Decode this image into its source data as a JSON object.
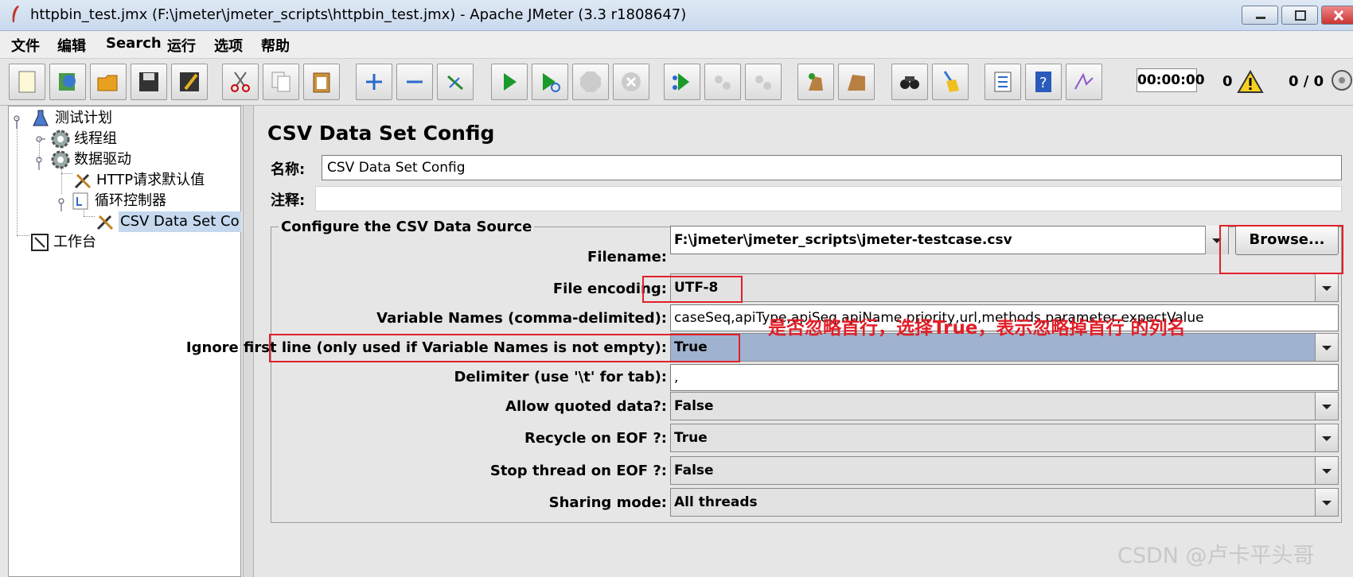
{
  "window": {
    "title": "httpbin_test.jmx (F:\\jmeter\\jmeter_scripts\\httpbin_test.jmx) - Apache JMeter (3.3 r1808647)"
  },
  "menu": [
    "文件",
    "编辑",
    "Search",
    "运行",
    "选项",
    "帮助"
  ],
  "toolbar": {
    "timer": "00:00:00",
    "error_count": "0",
    "thread_count": "0 / 0",
    "icons": [
      "new-icon",
      "templates-icon",
      "open-icon",
      "save-icon",
      "save-as-icon",
      "cut-icon",
      "copy-icon",
      "paste-icon",
      "expand-icon",
      "collapse-icon",
      "toggle-icon",
      "start-icon",
      "start-no-pause-icon",
      "stop-icon",
      "shutdown-icon",
      "remote-start-icon",
      "remote-stop-icon",
      "remote-exit-icon",
      "clear-icon",
      "clear-all-icon",
      "search-icon",
      "reset-search-icon",
      "function-helper-icon",
      "help-icon",
      "log-viewer-icon"
    ]
  },
  "tree": {
    "nodes": [
      "测试计划",
      "线程组",
      "数据驱动",
      "HTTP请求默认值",
      "循环控制器",
      "CSV Data Set Co",
      "工作台"
    ]
  },
  "panel": {
    "title": "CSV Data Set Config",
    "name_label": "名称:",
    "name_value": "CSV Data Set Config",
    "comment_label": "注释:",
    "group_title": "Configure the CSV Data Source",
    "filename_label": "Filename:",
    "filename_value": "F:\\jmeter\\jmeter_scripts\\jmeter-testcase.csv",
    "browse_label": "Browse...",
    "encoding_label": "File encoding:",
    "encoding_value": "UTF-8",
    "varnames_label": "Variable Names (comma-delimited):",
    "varnames_value": "caseSeq,apiType,apiSeq,apiName,priority,url,methods,parameter,expectValue",
    "ignore_label": "Ignore first line (only used if Variable Names is not empty):",
    "ignore_value": "True",
    "delimiter_label": "Delimiter (use '\\t' for tab):",
    "delimiter_value": ",",
    "quoted_label": "Allow quoted data?:",
    "quoted_value": "False",
    "recycle_label": "Recycle on EOF ?:",
    "recycle_value": "True",
    "stop_label": "Stop thread on EOF ?:",
    "stop_value": "False",
    "sharing_label": "Sharing mode:",
    "sharing_value": "All threads"
  },
  "annotation": "是否忽略首行，选择True，表示忽略掉首行 的列名",
  "watermark": "CSDN @卢卡平头哥",
  "colors": {
    "accent_red": "#e0202a",
    "selection": "#c5d8ee",
    "highlight_row": "#9fb3d0"
  }
}
